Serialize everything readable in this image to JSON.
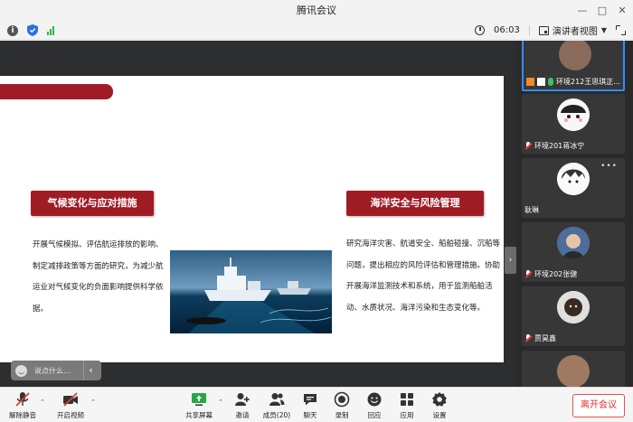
{
  "window": {
    "title": "腾讯会议"
  },
  "infobar": {
    "time": "06:03",
    "view_mode": "演讲者视图"
  },
  "slide": {
    "left_heading": "气候变化与应对措施",
    "left_text": "开展气候模拟、评估航运排放的影响、制定减排政策等方面的研究，为减少航运业对气候变化的负面影响提供科学依据。",
    "right_heading": "海洋安全与风险管理",
    "right_text": "研究海洋灾害、航道安全、船舶碰撞、沉船等问题，提出相应的风险评估和管理措施。协助开展海洋监测技术和系统，用于监测船舶活动、水质状况、海洋污染和生态变化等。"
  },
  "chat": {
    "placeholder": "说点什么..."
  },
  "participants": [
    {
      "name": "环境212王思琪正..."
    },
    {
      "name": "环境201蒋冰宁"
    },
    {
      "name": "耿琳"
    },
    {
      "name": "环境202张健"
    },
    {
      "name": "贾昊鑫"
    },
    {
      "name": ""
    }
  ],
  "toolbar": {
    "mute": "解除静音",
    "video": "开启视频",
    "share": "共享屏幕",
    "invite": "邀请",
    "members": "成员(20)",
    "chat": "聊天",
    "record": "录制",
    "replay": "回应",
    "apps": "应用",
    "settings": "设置",
    "leave": "离开会议"
  },
  "colors": {
    "brand_red": "#a01c25",
    "accent_blue": "#2e8fff",
    "leave_red": "#e25050"
  }
}
